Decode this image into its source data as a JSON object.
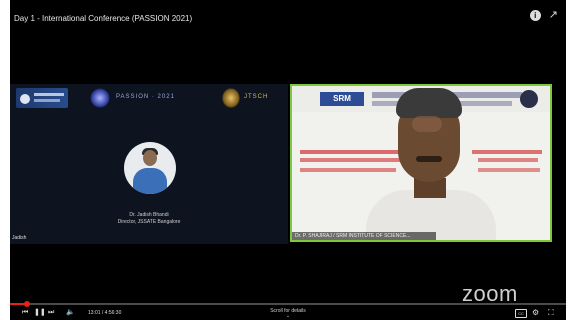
{
  "video": {
    "title": "Day 1 - International Conference (PASSION 2021)",
    "progress_fraction": 0.03
  },
  "top_icons": {
    "info_label": "i",
    "share_label": "↗"
  },
  "left_tile": {
    "logo_2_text": "PASSION · 2021",
    "logo_3_text": "JTSCH",
    "speaker_name": "Dr. Jadish Bhandi",
    "speaker_role": "Director, JSSATE Bangalore",
    "participant_label": "Jadish"
  },
  "right_tile": {
    "srm_label": "SRM",
    "name_bar": "Dr. P. SHAJIRAJ / SRM INSTITUTE OF SCIENCE..."
  },
  "branding": {
    "zoom_label": "zoom"
  },
  "controls": {
    "time": "13:01 / 4:56:30",
    "scroll_hint": "Scroll for details",
    "scroll_arrow": "⌄"
  },
  "colors": {
    "active_speaker_border": "#7ec83a",
    "progress": "#e62117"
  }
}
